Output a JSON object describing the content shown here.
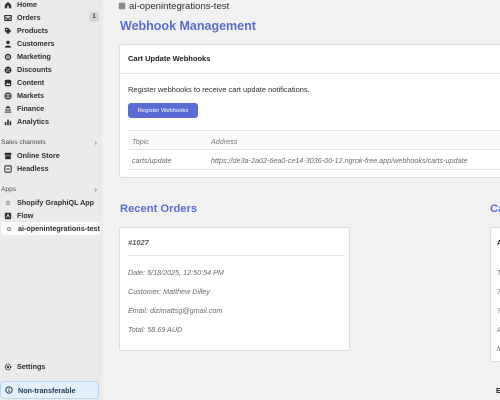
{
  "sidebar": {
    "items": [
      {
        "label": "Home",
        "icon": "home-icon"
      },
      {
        "label": "Orders",
        "icon": "orders-icon",
        "badge": "1"
      },
      {
        "label": "Products",
        "icon": "tag-icon"
      },
      {
        "label": "Customers",
        "icon": "person-icon"
      },
      {
        "label": "Marketing",
        "icon": "target-icon"
      },
      {
        "label": "Discounts",
        "icon": "discount-icon"
      },
      {
        "label": "Content",
        "icon": "content-icon"
      },
      {
        "label": "Markets",
        "icon": "globe-icon"
      },
      {
        "label": "Finance",
        "icon": "bank-icon"
      },
      {
        "label": "Analytics",
        "icon": "chart-icon"
      }
    ],
    "sales_channels_label": "Sales channels",
    "sales_channels": [
      {
        "label": "Online Store",
        "icon": "store-icon"
      },
      {
        "label": "Headless",
        "icon": "headless-icon"
      }
    ],
    "apps_label": "Apps",
    "apps": [
      {
        "label": "Shopify GraphiQL App"
      },
      {
        "label": "Flow",
        "icon": "flow-icon"
      },
      {
        "label": "ai-openintegrations-test"
      }
    ],
    "settings_label": "Settings",
    "non_transferable_label": "Non-transferable"
  },
  "header": {
    "app_name": "ai-openintegrations-test"
  },
  "main": {
    "title": "Webhook Management",
    "webhook_card": {
      "title": "Cart Update Webhooks",
      "description": "Register webhooks to receive cart update notifications.",
      "button_label": "Register Webhooks",
      "columns": [
        "Topic",
        "Address"
      ],
      "rows": [
        {
          "topic": "carts/update",
          "address": "https://de3a-2a02-6ea0-ce14-3036-00-12.ngrok-free.app/webhooks/carts-update"
        }
      ]
    },
    "recent_orders": {
      "title": "Recent Orders",
      "order_id": "#1027",
      "date": "Date: 5/18/2025, 12:50:54 PM",
      "customer": "Customer: Matthew Dilley",
      "email": "Email: dizimattsg@gmail.com",
      "total": "Total: 58.69 AUD"
    },
    "cut_section_title": "Ca",
    "cut_card_lines": [
      "A",
      "T",
      "7",
      "7",
      "A",
      "M",
      "E"
    ]
  },
  "colors": {
    "accent": "#5b6dcd",
    "button": "#5b6cd4",
    "sidebar_bg": "#ebebeb",
    "page_bg": "#f1f1f1",
    "notice_bg": "#e4f0fb"
  }
}
